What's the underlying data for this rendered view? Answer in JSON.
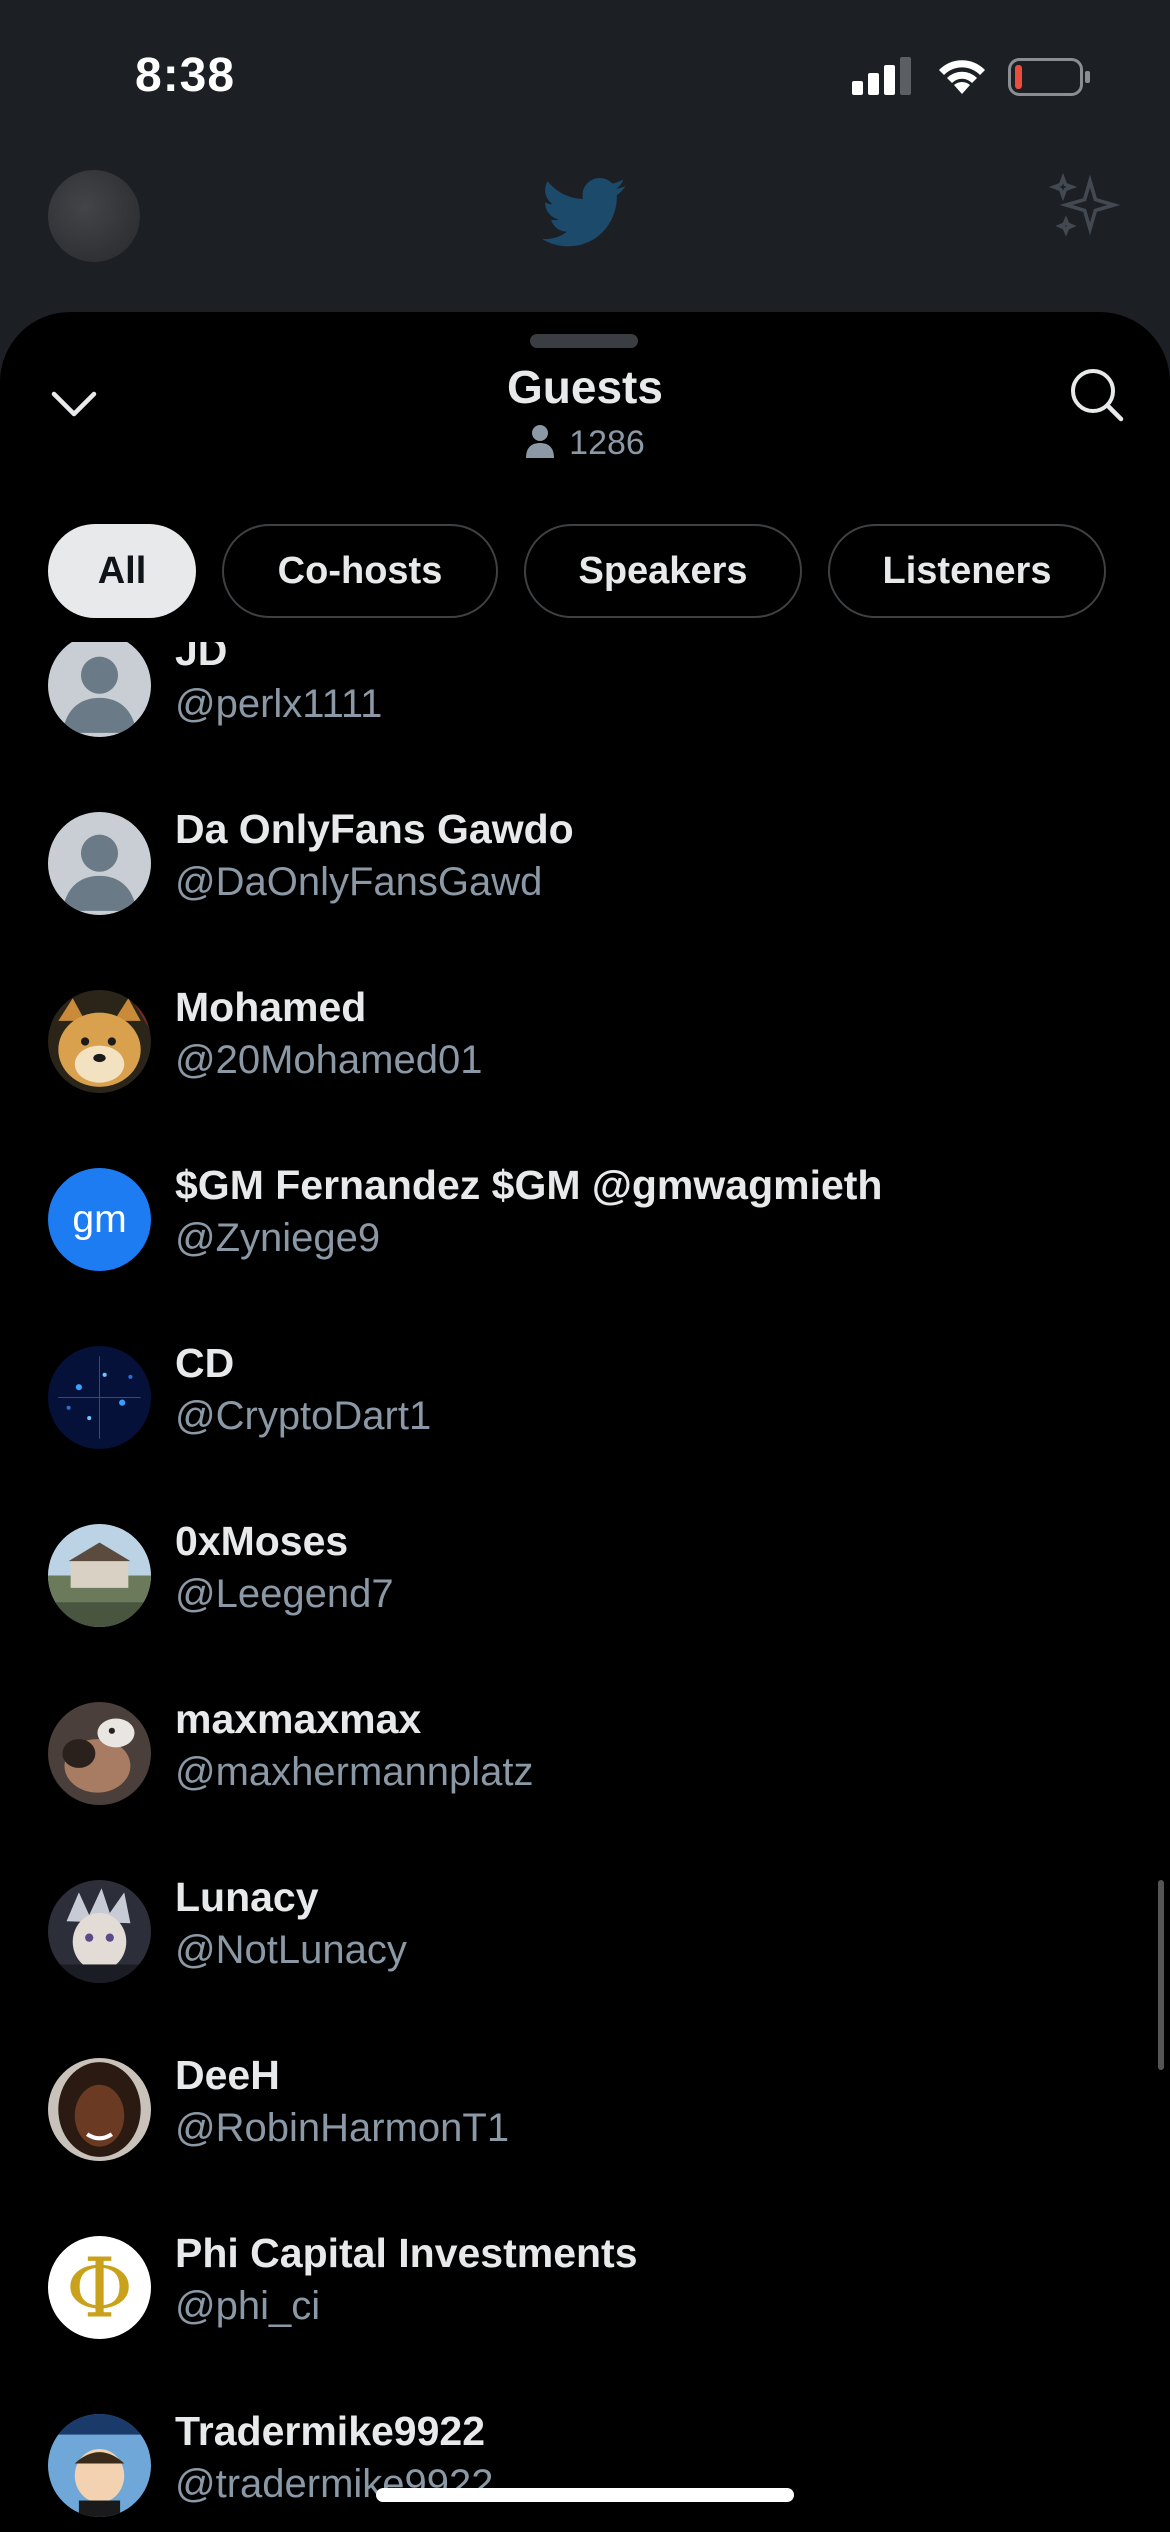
{
  "status_bar": {
    "time": "8:38",
    "icons": [
      "cellular-signal-icon",
      "wifi-icon",
      "battery-low-icon"
    ]
  },
  "background_bar": {
    "icons": [
      "profile-avatar",
      "twitter-bird-icon",
      "sparkle-icon"
    ]
  },
  "sheet": {
    "title": "Guests",
    "guest_count": "1286",
    "collapse_icon": "chevron-down-icon",
    "search_icon": "search-icon",
    "filters": [
      {
        "label": "All",
        "active": true
      },
      {
        "label": "Co-hosts",
        "active": false
      },
      {
        "label": "Speakers",
        "active": false
      },
      {
        "label": "Listeners",
        "active": false
      }
    ]
  },
  "guests": [
    {
      "name": "JD",
      "handle": "@perlx1111",
      "avatar": "default"
    },
    {
      "name": "Da OnlyFans Gawdo",
      "handle": "@DaOnlyFansGawd",
      "avatar": "default"
    },
    {
      "name": "Mohamed",
      "handle": "@20Mohamed01",
      "avatar": "doge"
    },
    {
      "name": "$GM Fernandez $GM @gmwagmieth",
      "handle": "@Zyniege9",
      "avatar": "gm",
      "avatar_text": "gm"
    },
    {
      "name": "CD",
      "handle": "@CryptoDart1",
      "avatar": "digital"
    },
    {
      "name": "0xMoses",
      "handle": "@Leegend7",
      "avatar": "landscape"
    },
    {
      "name": "maxmaxmax",
      "handle": "@maxhermannplatz",
      "avatar": "photo"
    },
    {
      "name": "Lunacy",
      "handle": "@NotLunacy",
      "avatar": "anime"
    },
    {
      "name": "DeeH",
      "handle": "@RobinHarmonT1",
      "avatar": "portrait"
    },
    {
      "name": "Phi Capital Investments",
      "handle": "@phi_ci",
      "avatar": "phi",
      "avatar_text": "Φ"
    },
    {
      "name": "Tradermike9922",
      "handle": "@tradermike9922",
      "avatar": "cartoon"
    }
  ],
  "colors": {
    "background": "#000000",
    "primary_text": "#e7e9ea",
    "secondary_text": "#8b98a5",
    "chip_border": "#3e4144",
    "active_chip": "#e7e9ea",
    "gm_blue": "#1d7cf2"
  }
}
